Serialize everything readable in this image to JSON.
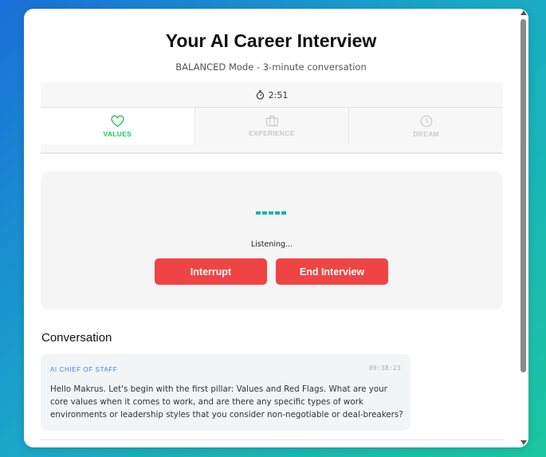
{
  "header": {
    "title": "Your AI Career Interview",
    "subtitle": "BALANCED Mode - 3-minute conversation"
  },
  "timer": {
    "value": "2:51",
    "icon": "stopwatch-icon"
  },
  "tabs": [
    {
      "label": "VALUES",
      "icon": "heart-icon",
      "active": true
    },
    {
      "label": "EXPERIENCE",
      "icon": "briefcase-icon",
      "active": false
    },
    {
      "label": "DREAM",
      "icon": "clock-icon",
      "active": false
    }
  ],
  "status": {
    "text": "Listening...",
    "interrupt_label": "Interrupt",
    "end_label": "End Interview"
  },
  "conversation": {
    "title": "Conversation",
    "messages": [
      {
        "sender": "AI CHIEF OF STAFF",
        "time": "09:38:23",
        "text": "Hello Makrus. Let's begin with the first pillar: Values and Red Flags. What are your core values when it comes to work, and are there any specific types of work environments or leadership styles that you consider non-negotiable or deal-breakers?"
      }
    ]
  },
  "colors": {
    "accent_green": "#22c55e",
    "button_red": "#ef4444",
    "sender_blue": "#3b82f6",
    "dots_teal": "#17b3a3"
  }
}
